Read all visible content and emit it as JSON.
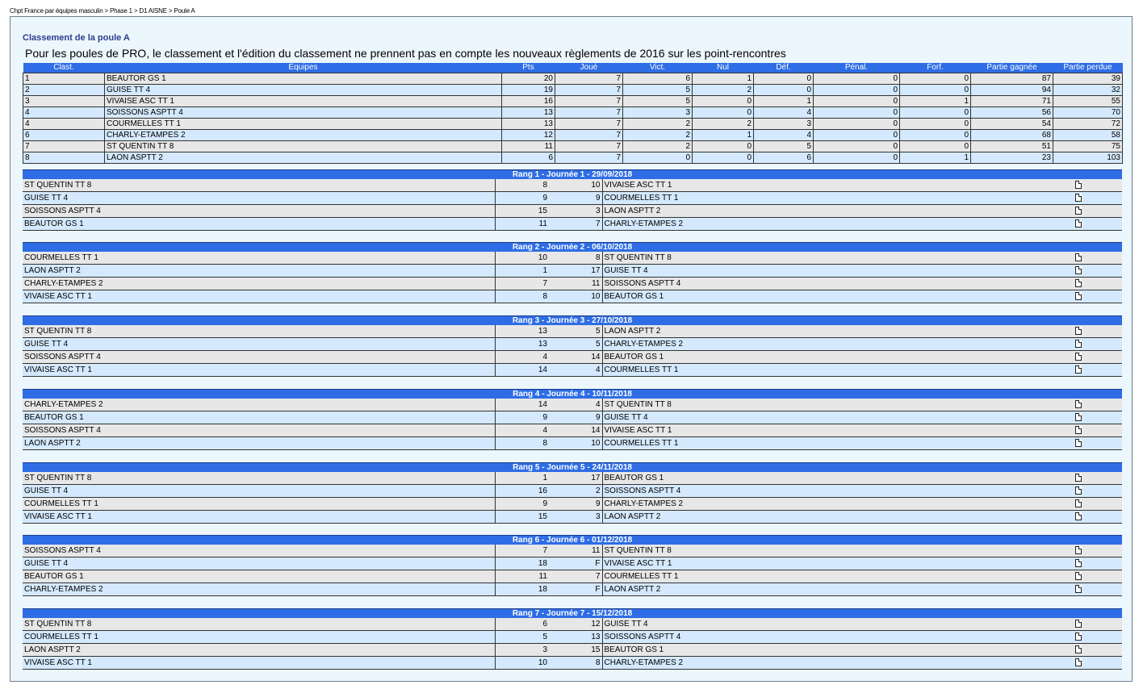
{
  "breadcrumb": "Chpt France par équipes masculin > Phase 1 > D1 AISNE > Poule A",
  "title": "Classement de la poule A",
  "notice": "Pour les poules de PRO, le classement et l'édition du classement ne prennent pas en compte les nouveaux règlements de 2016 sur les point-rencontres",
  "standings": {
    "headers": [
      "Clast.",
      "Equipes",
      "Pts",
      "Joué",
      "Vict.",
      "Nul",
      "Déf.",
      "Pénal.",
      "Forf.",
      "Partie gagnée",
      "Partie perdue"
    ],
    "rows": [
      [
        "1",
        "BEAUTOR GS 1",
        "20",
        "7",
        "6",
        "1",
        "0",
        "0",
        "0",
        "87",
        "39"
      ],
      [
        "2",
        "GUISE TT 4",
        "19",
        "7",
        "5",
        "2",
        "0",
        "0",
        "0",
        "94",
        "32"
      ],
      [
        "3",
        "VIVAISE ASC TT 1",
        "16",
        "7",
        "5",
        "0",
        "1",
        "0",
        "1",
        "71",
        "55"
      ],
      [
        "4",
        "SOISSONS ASPTT 4",
        "13",
        "7",
        "3",
        "0",
        "4",
        "0",
        "0",
        "56",
        "70"
      ],
      [
        "4",
        "COURMELLES TT 1",
        "13",
        "7",
        "2",
        "2",
        "3",
        "0",
        "0",
        "54",
        "72"
      ],
      [
        "6",
        "CHARLY-ETAMPES 2",
        "12",
        "7",
        "2",
        "1",
        "4",
        "0",
        "0",
        "68",
        "58"
      ],
      [
        "7",
        "ST QUENTIN TT 8",
        "11",
        "7",
        "2",
        "0",
        "5",
        "0",
        "0",
        "51",
        "75"
      ],
      [
        "8",
        "LAON ASPTT 2",
        "6",
        "7",
        "0",
        "0",
        "6",
        "0",
        "1",
        "23",
        "103"
      ]
    ]
  },
  "rounds": [
    {
      "title": "Rang 1 - Journée 1 - 29/09/2018",
      "matches": [
        [
          "ST QUENTIN TT 8",
          "8",
          "10",
          "VIVAISE ASC TT 1"
        ],
        [
          "GUISE TT 4",
          "9",
          "9",
          "COURMELLES TT 1"
        ],
        [
          "SOISSONS ASPTT 4",
          "15",
          "3",
          "LAON ASPTT 2"
        ],
        [
          "BEAUTOR GS 1",
          "11",
          "7",
          "CHARLY-ETAMPES 2"
        ]
      ]
    },
    {
      "title": "Rang 2 - Journée 2 - 06/10/2018",
      "matches": [
        [
          "COURMELLES TT 1",
          "10",
          "8",
          "ST QUENTIN TT 8"
        ],
        [
          "LAON ASPTT 2",
          "1",
          "17",
          "GUISE TT 4"
        ],
        [
          "CHARLY-ETAMPES 2",
          "7",
          "11",
          "SOISSONS ASPTT 4"
        ],
        [
          "VIVAISE ASC TT 1",
          "8",
          "10",
          "BEAUTOR GS 1"
        ]
      ]
    },
    {
      "title": "Rang 3 - Journée 3 - 27/10/2018",
      "matches": [
        [
          "ST QUENTIN TT 8",
          "13",
          "5",
          "LAON ASPTT 2"
        ],
        [
          "GUISE TT 4",
          "13",
          "5",
          "CHARLY-ETAMPES 2"
        ],
        [
          "SOISSONS ASPTT 4",
          "4",
          "14",
          "BEAUTOR GS 1"
        ],
        [
          "VIVAISE ASC TT 1",
          "14",
          "4",
          "COURMELLES TT 1"
        ]
      ]
    },
    {
      "title": "Rang 4 - Journée 4 - 10/11/2018",
      "matches": [
        [
          "CHARLY-ETAMPES 2",
          "14",
          "4",
          "ST QUENTIN TT 8"
        ],
        [
          "BEAUTOR GS 1",
          "9",
          "9",
          "GUISE TT 4"
        ],
        [
          "SOISSONS ASPTT 4",
          "4",
          "14",
          "VIVAISE ASC TT 1"
        ],
        [
          "LAON ASPTT 2",
          "8",
          "10",
          "COURMELLES TT 1"
        ]
      ]
    },
    {
      "title": "Rang 5 - Journée 5 - 24/11/2018",
      "matches": [
        [
          "ST QUENTIN TT 8",
          "1",
          "17",
          "BEAUTOR GS 1"
        ],
        [
          "GUISE TT 4",
          "16",
          "2",
          "SOISSONS ASPTT 4"
        ],
        [
          "COURMELLES TT 1",
          "9",
          "9",
          "CHARLY-ETAMPES 2"
        ],
        [
          "VIVAISE ASC TT 1",
          "15",
          "3",
          "LAON ASPTT 2"
        ]
      ]
    },
    {
      "title": "Rang 6 - Journée 6 - 01/12/2018",
      "matches": [
        [
          "SOISSONS ASPTT 4",
          "7",
          "11",
          "ST QUENTIN TT 8"
        ],
        [
          "GUISE TT 4",
          "18",
          "F",
          "VIVAISE ASC TT 1"
        ],
        [
          "BEAUTOR GS 1",
          "11",
          "7",
          "COURMELLES TT 1"
        ],
        [
          "CHARLY-ETAMPES 2",
          "18",
          "F",
          "LAON ASPTT 2"
        ]
      ]
    },
    {
      "title": "Rang 7 - Journée 7 - 15/12/2018",
      "matches": [
        [
          "ST QUENTIN TT 8",
          "6",
          "12",
          "GUISE TT 4"
        ],
        [
          "COURMELLES TT 1",
          "5",
          "13",
          "SOISSONS ASPTT 4"
        ],
        [
          "LAON ASPTT 2",
          "3",
          "15",
          "BEAUTOR GS 1"
        ],
        [
          "VIVAISE ASC TT 1",
          "10",
          "8",
          "CHARLY-ETAMPES 2"
        ]
      ]
    }
  ],
  "icons": {
    "match_sheet": "document-icon"
  },
  "colors": {
    "header_blue": "#2e6de5",
    "row_gray": "#e7e7e7",
    "row_blue": "#d4e9fd",
    "title_blue": "#2b3c8c",
    "panel_bg": "#ecf6fd"
  }
}
